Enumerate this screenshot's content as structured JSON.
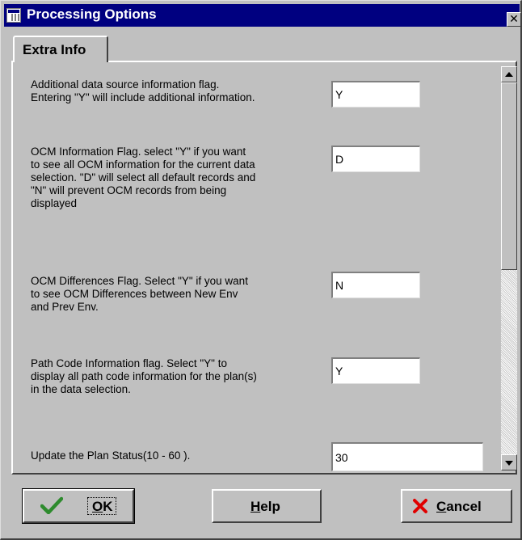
{
  "window": {
    "title": "Processing Options",
    "close_glyph": "✕"
  },
  "tabs": [
    {
      "label": "Extra Info",
      "selected": true
    }
  ],
  "options": [
    {
      "label_lines": [
        "Additional data source information flag.",
        "Entering \"Y\" will include additional information."
      ],
      "value": "Y"
    },
    {
      "label_lines": [
        "OCM Information Flag.  select \"Y\" if you want",
        "to see all OCM information for the current data",
        "selection. \"D\" will select all default records and",
        "\"N\" will prevent OCM records from being",
        "displayed"
      ],
      "value": "D"
    },
    {
      "label_lines": [
        "OCM Differences Flag. Select \"Y\" if you want",
        "to see OCM Differences between New Env",
        "and Prev Env."
      ],
      "value": "N"
    },
    {
      "label_lines": [
        "Path Code Information flag.  Select \"Y\" to",
        "display all path code information for the plan(s)",
        "in the data selection."
      ],
      "value": "Y"
    },
    {
      "label_lines": [
        "Update the Plan Status(10 - 60 )."
      ],
      "value": "30"
    }
  ],
  "buttons": {
    "ok": {
      "label": "OK",
      "mnemonic": "O",
      "rest": "K",
      "icon": "checkmark-icon"
    },
    "help": {
      "label": "Help",
      "mnemonic": "H",
      "rest": "elp"
    },
    "cancel": {
      "label": "Cancel",
      "mnemonic": "C",
      "rest": "ancel",
      "icon": "red-x-icon"
    }
  },
  "colors": {
    "titlebar": "#000080",
    "face": "#c0c0c0",
    "check": "#2e8b2e",
    "cancel_x": "#e00000"
  }
}
